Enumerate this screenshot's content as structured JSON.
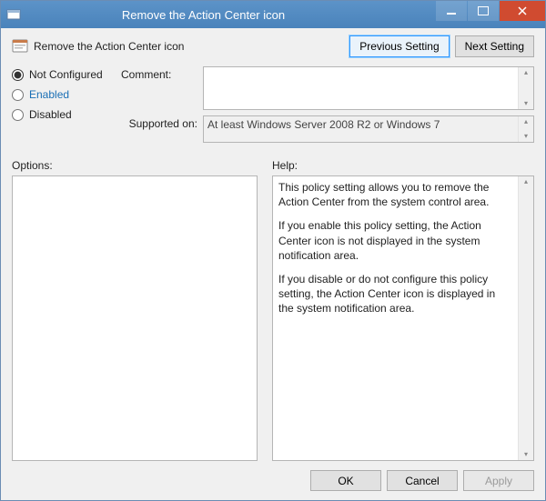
{
  "window": {
    "title": "Remove the Action Center icon"
  },
  "header": {
    "title": "Remove the Action Center icon",
    "prev_label": "Previous Setting",
    "next_label": "Next Setting"
  },
  "state": {
    "not_configured_label": "Not Configured",
    "enabled_label": "Enabled",
    "disabled_label": "Disabled",
    "selected": "not_configured"
  },
  "fields": {
    "comment_label": "Comment:",
    "comment_value": "",
    "supported_label": "Supported on:",
    "supported_value": "At least Windows Server 2008 R2 or Windows 7"
  },
  "panels": {
    "options_label": "Options:",
    "help_label": "Help:",
    "help_paragraphs": [
      "This policy setting allows you to remove the Action Center from the system control area.",
      "If you enable this policy setting, the Action Center icon is not displayed in the system notification area.",
      "If you disable or do not configure this policy setting, the Action Center icon is displayed in the system notification area."
    ]
  },
  "footer": {
    "ok_label": "OK",
    "cancel_label": "Cancel",
    "apply_label": "Apply"
  }
}
